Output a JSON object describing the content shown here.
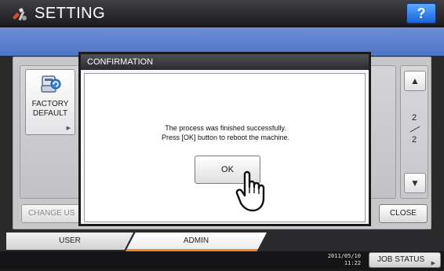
{
  "header": {
    "title": "SETTING",
    "help_label": "?"
  },
  "panel": {
    "factory_default_label": "FACTORY\nDEFAULT",
    "change_user_label": "CHANGE US",
    "close_label": "CLOSE",
    "page_current": "2",
    "page_total": "2"
  },
  "dialog": {
    "title": "CONFIRMATION",
    "message_line1": "The process was finished successfully.",
    "message_line2": "Press [OK] button to reboot the machine.",
    "ok_label": "OK"
  },
  "tabs": [
    {
      "label": "USER"
    },
    {
      "label": "ADMIN"
    }
  ],
  "statusbar": {
    "date": "2011/05/10",
    "time": "11:22",
    "job_status_label": "JOB STATUS"
  },
  "colors": {
    "help_blue": "#1a63d8",
    "band_blue": "#5a7ccb",
    "active_tab_accent": "#ef8a18"
  }
}
